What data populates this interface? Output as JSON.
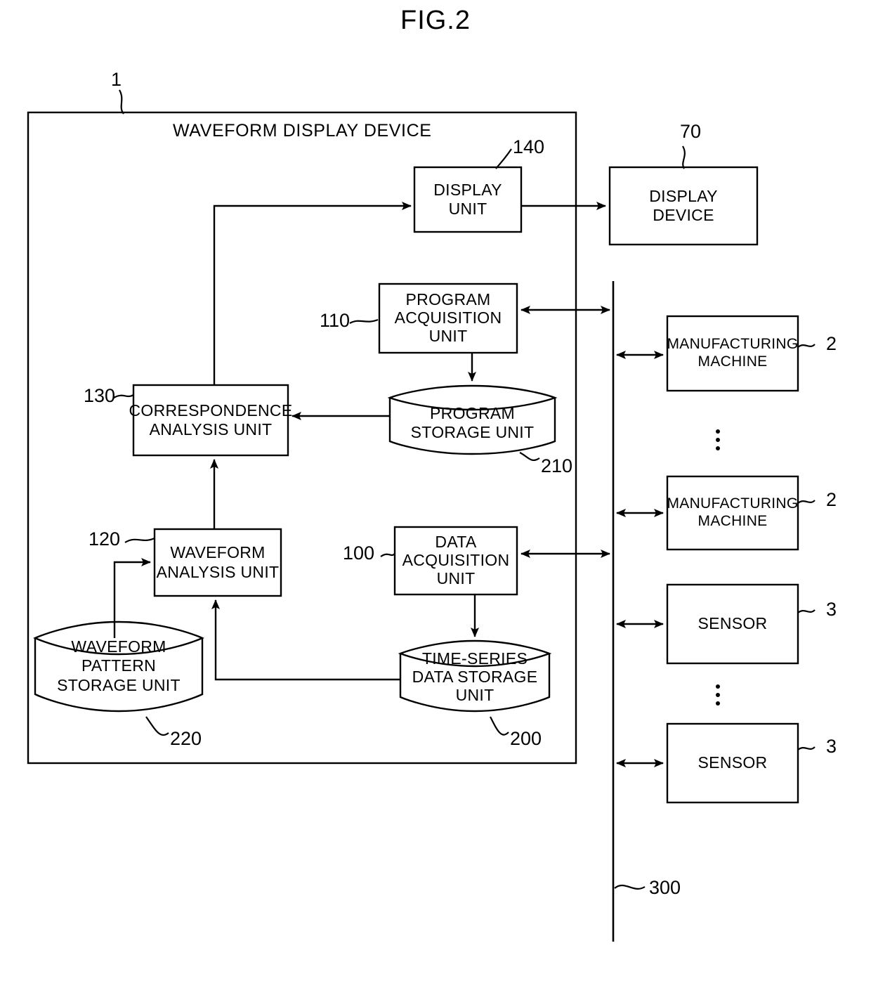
{
  "figure": {
    "title": "FIG.2"
  },
  "device": {
    "title": "WAVEFORM DISPLAY DEVICE",
    "ref": "1"
  },
  "blocks": {
    "display_unit": {
      "label": "DISPLAY\nUNIT",
      "ref": "140"
    },
    "display_device": {
      "label": "DISPLAY\nDEVICE",
      "ref": "70"
    },
    "program_acquisition_unit": {
      "label": "PROGRAM\nACQUISITION\nUNIT",
      "ref": "110"
    },
    "program_storage_unit": {
      "label": "PROGRAM\nSTORAGE UNIT",
      "ref": "210"
    },
    "correspondence_analysis_unit": {
      "label": "CORRESPONDENCE\nANALYSIS UNIT",
      "ref": "130"
    },
    "waveform_analysis_unit": {
      "label": "WAVEFORM\nANALYSIS UNIT",
      "ref": "120"
    },
    "data_acquisition_unit": {
      "label": "DATA\nACQUISITION\nUNIT",
      "ref": "100"
    },
    "waveform_pattern_storage_unit": {
      "label": "WAVEFORM PATTERN\nSTORAGE UNIT",
      "ref": "220"
    },
    "time_series_data_storage_unit": {
      "label": "TIME-SERIES\nDATA STORAGE\nUNIT",
      "ref": "200"
    },
    "manufacturing_machine_1": {
      "label": "MANUFACTURING\nMACHINE",
      "ref": "2"
    },
    "manufacturing_machine_2": {
      "label": "MANUFACTURING\nMACHINE",
      "ref": "2"
    },
    "sensor_1": {
      "label": "SENSOR",
      "ref": "3"
    },
    "sensor_2": {
      "label": "SENSOR",
      "ref": "3"
    }
  },
  "bus": {
    "ref": "300"
  },
  "colors": {
    "line": "#000000",
    "background": "#ffffff"
  }
}
